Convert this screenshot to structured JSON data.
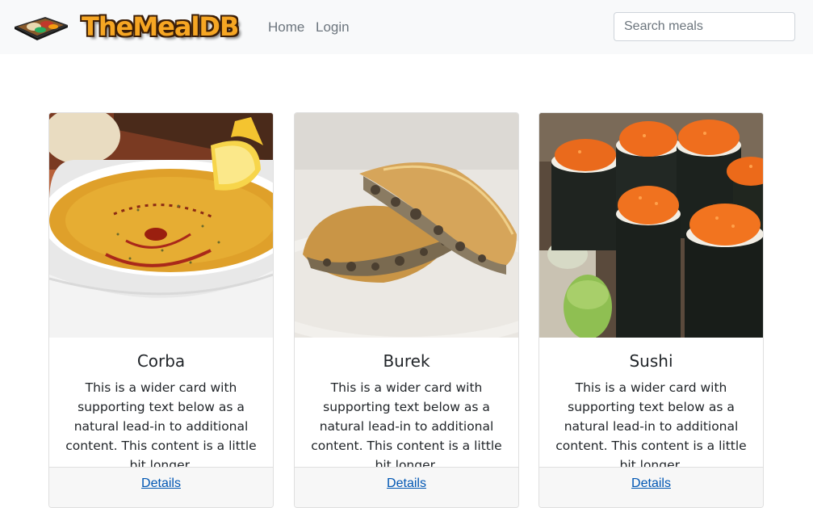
{
  "brand": {
    "name": "TheMealDB"
  },
  "nav": {
    "items": [
      {
        "label": "Home"
      },
      {
        "label": "Login"
      }
    ]
  },
  "search": {
    "placeholder": "Search meals",
    "value": ""
  },
  "meals": [
    {
      "title": "Corba",
      "text": "This is a wider card with supporting text below as a natural lead-in to additional content. This content is a little bit longer.",
      "link": "Details"
    },
    {
      "title": "Burek",
      "text": "This is a wider card with supporting text below as a natural lead-in to additional content. This content is a little bit longer.",
      "link": "Details"
    },
    {
      "title": "Sushi",
      "text": "This is a wider card with supporting text below as a natural lead-in to additional content. This content is a little bit longer.",
      "link": "Details"
    }
  ],
  "colors": {
    "navbar_bg": "#f8f9fa",
    "link": "#0056b3",
    "brand_orange": "#f6a623"
  }
}
